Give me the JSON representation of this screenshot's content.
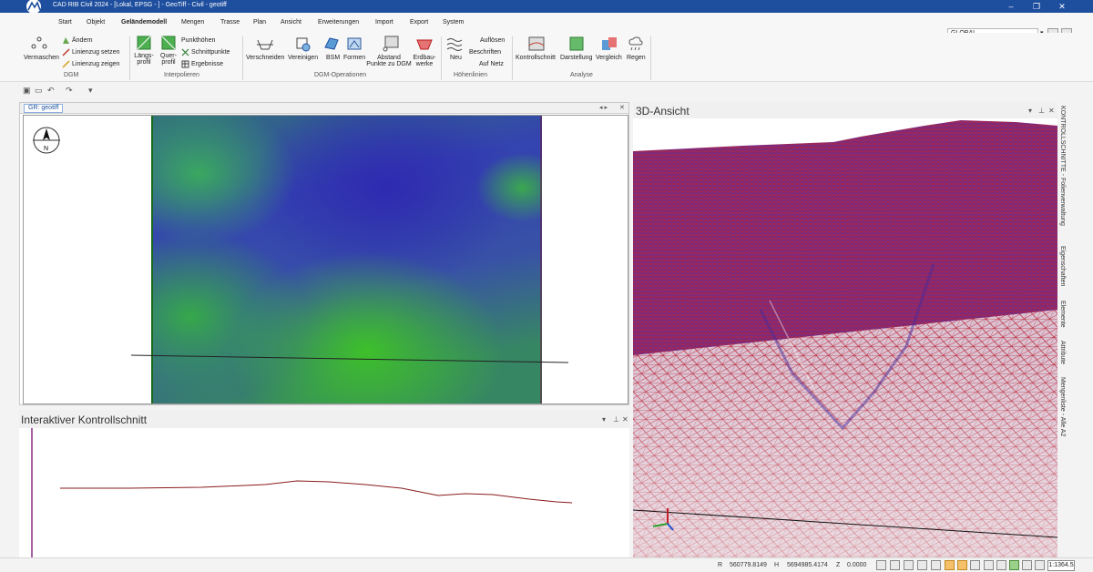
{
  "window": {
    "title": "CAD RIB Civil 2024 - [Lokal, EPSG - ] - GeoTiff - Civil - geotiff",
    "minimize": "–",
    "restore": "❐",
    "close": "✕"
  },
  "menu": {
    "tabs": [
      "Start",
      "Objekt",
      "Geländemodell",
      "Mengen",
      "Trasse",
      "Plan",
      "Ansicht",
      "Erweiterungen",
      "Import",
      "Export",
      "System"
    ],
    "active_tab": "Geländemodell",
    "coordinate_system": "GLOBAL"
  },
  "ribbon": {
    "dgm": {
      "label": "DGM",
      "vermaschen": "Vermaschen",
      "aendern": "Ändern",
      "linienzug_setzen": "Linienzug setzen",
      "linienzug_zeigen": "Linienzug zeigen"
    },
    "interpolieren": {
      "label": "Interpolieren",
      "laengsprofil_1": "Längs-",
      "laengsprofil_2": "profil",
      "querprofil_1": "Quer-",
      "querprofil_2": "profil",
      "punkthoehen": "Punkthöhen",
      "schnittpunkte": "Schnittpunkte",
      "ergebnisse": "Ergebnisse"
    },
    "dgm_operationen": {
      "label": "DGM-Operationen",
      "verschneiden": "Verschneiden",
      "vereinigen": "Vereinigen",
      "bsm": "BSM",
      "formen": "Formen",
      "abstand_1": "Abstand",
      "abstand_2": "Punkte zu DGM",
      "erdbau_1": "Erdbau-",
      "erdbau_2": "werke"
    },
    "hoehenlinien": {
      "label": "Höhenlinien",
      "neu": "Neu",
      "aufloesen": "Auflösen",
      "beschriften": "Beschriften",
      "auf_netz": "Auf Netz"
    },
    "analyse": {
      "label": "Analyse",
      "kontrollschnitt": "Kontrollschnitt",
      "darstellung": "Darstellung",
      "vergleich": "Vergleich",
      "regen": "Regen"
    }
  },
  "panes": {
    "gr_tab": "GR: geotiff",
    "north_label": "N",
    "kontrollschnitt_title": "Interaktiver Kontrollschnitt",
    "ansicht_title": "3D-Ansicht",
    "pane_controls": "▾ ⊥ ✕"
  },
  "sidebar": {
    "items": [
      "KONTROLLSCHNITTE - Folienverwaltung",
      "Eigenschaften",
      "Elemente",
      "Attribute",
      "Mengenliste - Alle A2"
    ]
  },
  "status": {
    "r_label": "R",
    "r_value": "560779.8149",
    "h_label": "H",
    "h_value": "5694985.4174",
    "z_label": "Z",
    "z_value": "0.0000",
    "scale": "1:1364.5"
  },
  "colors": {
    "titlebar": "#1e4e9e",
    "terrain_blue": "#3a40b8",
    "terrain_green": "#3ab830",
    "mesh_red": "#c0202a",
    "mesh_blue": "#4030c0"
  }
}
